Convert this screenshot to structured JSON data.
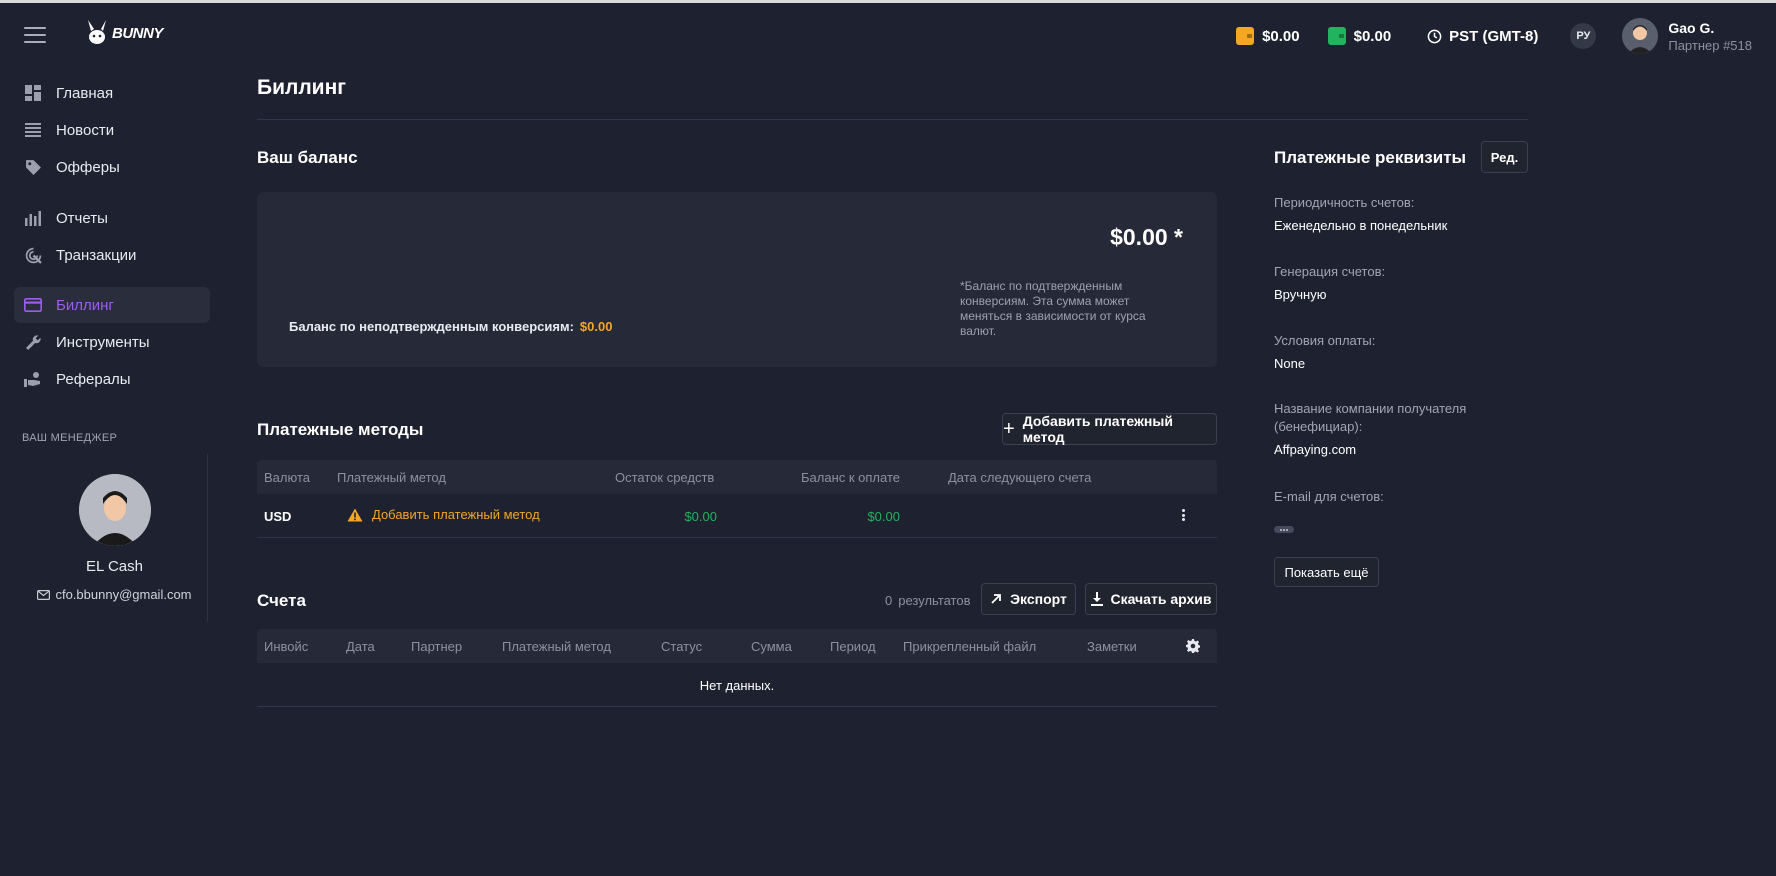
{
  "header": {
    "logo_text": "BUNNY",
    "wallet_orange": "$0.00",
    "wallet_green": "$0.00",
    "timezone": "PST (GMT-8)",
    "language": "РУ",
    "user_name": "Gao G.",
    "user_sub": "Партнер #518",
    "colors": {
      "orange": "#f5a623",
      "green": "#22b35e",
      "accent": "#9b5cf6"
    }
  },
  "sidebar": {
    "items": [
      {
        "label": "Главная",
        "icon": "dashboard-icon"
      },
      {
        "label": "Новости",
        "icon": "news-icon"
      },
      {
        "label": "Офферы",
        "icon": "tag-icon"
      },
      {
        "label": "Отчеты",
        "icon": "bar-chart-icon"
      },
      {
        "label": "Транзакции",
        "icon": "cursor-click-icon"
      },
      {
        "label": "Биллинг",
        "icon": "credit-card-icon",
        "active": true
      },
      {
        "label": "Инструменты",
        "icon": "wrench-icon"
      },
      {
        "label": "Рефералы",
        "icon": "referral-hand-icon"
      }
    ],
    "manager_title": "ВАШ МЕНЕДЖЕР",
    "manager_name": "EL Cash",
    "manager_email": "cfo.bbunny@gmail.com"
  },
  "main": {
    "title": "Биллинг",
    "balance": {
      "title": "Ваш баланс",
      "amount": "$0.00 *",
      "note": "*Баланс по подтвержденным конверсиям. Эта сумма может меняться в зависимости от курса валют.",
      "unconfirmed_label": "Баланс по неподтвержденным конверсиям:",
      "unconfirmed_value": "$0.00"
    },
    "methods": {
      "title": "Платежные методы",
      "add_button": "Добавить платежный метод",
      "columns": [
        "Валюта",
        "Платежный метод",
        "Остаток средств",
        "Баланс к оплате",
        "Дата следующего счета"
      ],
      "row": {
        "currency": "USD",
        "method": "Добавить платежный метод",
        "remaining": "$0.00",
        "to_pay": "$0.00",
        "next_date": ""
      }
    },
    "invoices": {
      "title": "Счета",
      "results_count": "0",
      "results_label": "результатов",
      "export_button": "Экспорт",
      "download_button": "Скачать архив",
      "columns": [
        "Инвойс",
        "Дата",
        "Партнер",
        "Платежный метод",
        "Статус",
        "Сумма",
        "Период",
        "Прикрепленный файл",
        "Заметки"
      ],
      "empty_text": "Нет данных."
    }
  },
  "requisites": {
    "title": "Платежные реквизиты",
    "edit_button": "Ред.",
    "fields": [
      {
        "label": "Периодичность счетов:",
        "value": "Еженедельно в понедельник"
      },
      {
        "label": "Генерация счетов:",
        "value": "Вручную"
      },
      {
        "label": "Условия оплаты:",
        "value": "None"
      },
      {
        "label": "Название компании получателя (бенефициар):",
        "value": "Affpaying.com"
      },
      {
        "label": "E-mail для счетов:",
        "value": ""
      }
    ],
    "show_more_button": "Показать ещё"
  }
}
